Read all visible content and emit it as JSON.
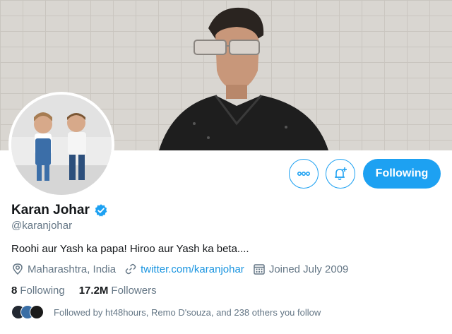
{
  "profile": {
    "name": "Karan Johar",
    "handle": "@karanjohar",
    "bio": "Roohi aur Yash ka papa! Hiroo aur Yash ka beta....",
    "location": "Maharashtra, India",
    "website": "twitter.com/karanjohar",
    "joined": "Joined July 2009"
  },
  "stats": {
    "following_count": "8",
    "following_label": "Following",
    "followers_count": "17.2M",
    "followers_label": "Followers"
  },
  "actions": {
    "follow_label": "Following"
  },
  "followed_by": "Followed by ht48hours, Remo D'souza, and 238 others you follow",
  "icons": {
    "more": "more-icon",
    "notify": "bell-plus-icon",
    "verified": "verified-badge-icon",
    "location": "location-pin-icon",
    "link": "link-icon",
    "calendar": "calendar-icon"
  },
  "colors": {
    "accent": "#1da1f2",
    "link": "#1b95e0",
    "secondary_text": "#657786"
  }
}
